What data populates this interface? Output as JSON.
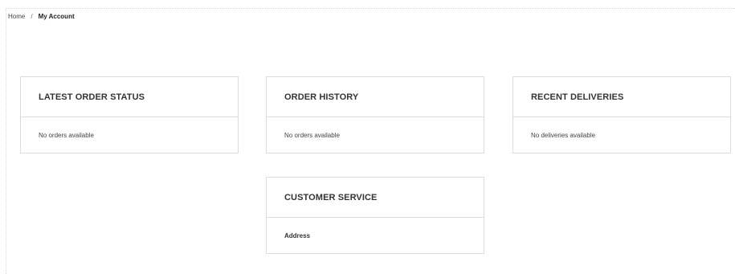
{
  "breadcrumb": {
    "home": "Home",
    "separator": "/",
    "current": "My Account"
  },
  "cards": {
    "latest_order_status": {
      "title": "LATEST ORDER STATUS",
      "body": "No orders available"
    },
    "order_history": {
      "title": "ORDER HISTORY",
      "body": "No orders available"
    },
    "recent_deliveries": {
      "title": "RECENT DELIVERIES",
      "body": "No deliveries available"
    },
    "customer_service": {
      "title": "CUSTOMER SERVICE",
      "body": "Address"
    }
  },
  "colors": {
    "border": "#dcdcdc",
    "text": "#333333",
    "background": "#ffffff"
  }
}
